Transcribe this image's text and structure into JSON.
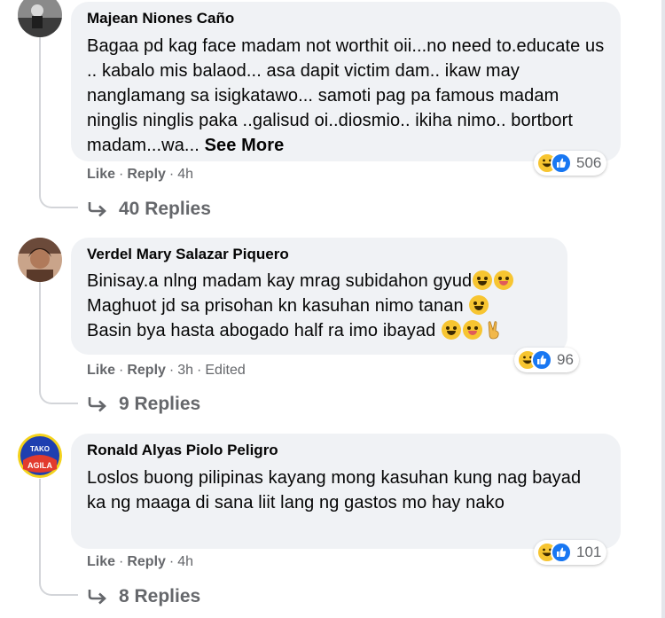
{
  "comments": [
    {
      "author": "Majean Niones Caño",
      "text": "Bagaa pd kag face madam not worthit oii...no need to.educate us .. kabalo mis balaod... asa dapit victim dam.. ikaw may nanglamang sa isigkatawo... samoti pag pa famous madam ninglis ninglis paka ..galisud oi..diosmio.. ikiha nimo.. bortbort madam...wa...",
      "see_more": "See More",
      "reaction_count": "506",
      "like": "Like",
      "reply": "Reply",
      "time": "4h",
      "edited": "",
      "replies": "40 Replies"
    },
    {
      "author": "Verdel Mary Salazar Piquero",
      "line1": "Binisay.a nlng madam kay mrag subidahon gyud",
      "line2": "Maghuot jd sa prisohan kn kasuhan nimo tanan",
      "line3": "Basin bya hasta abogado half ra imo ibayad",
      "reaction_count": "96",
      "like": "Like",
      "reply": "Reply",
      "time": "3h",
      "edited": "Edited",
      "replies": "9 Replies"
    },
    {
      "author": "Ronald Alyas Piolo Peligro",
      "text": "Loslos buong pilipinas kayang mong kasuhan kung nag bayad ka ng maaga di sana liit lang ng gastos mo hay nako",
      "reaction_count": "101",
      "like": "Like",
      "reply": "Reply",
      "time": "4h",
      "edited": "",
      "replies": "8 Replies"
    }
  ],
  "avatar3_text": {
    "top": "TAKO",
    "bottom": "AGILA"
  },
  "icons": {
    "haha": "haha-reaction-icon",
    "like": "like-reaction-icon",
    "reply_arrow": "reply-arrow-icon"
  },
  "colors": {
    "bubble": "#f0f2f5",
    "meta_text": "#65676b",
    "like_blue": "#1877f2",
    "haha_yellow": "#f7c531"
  }
}
